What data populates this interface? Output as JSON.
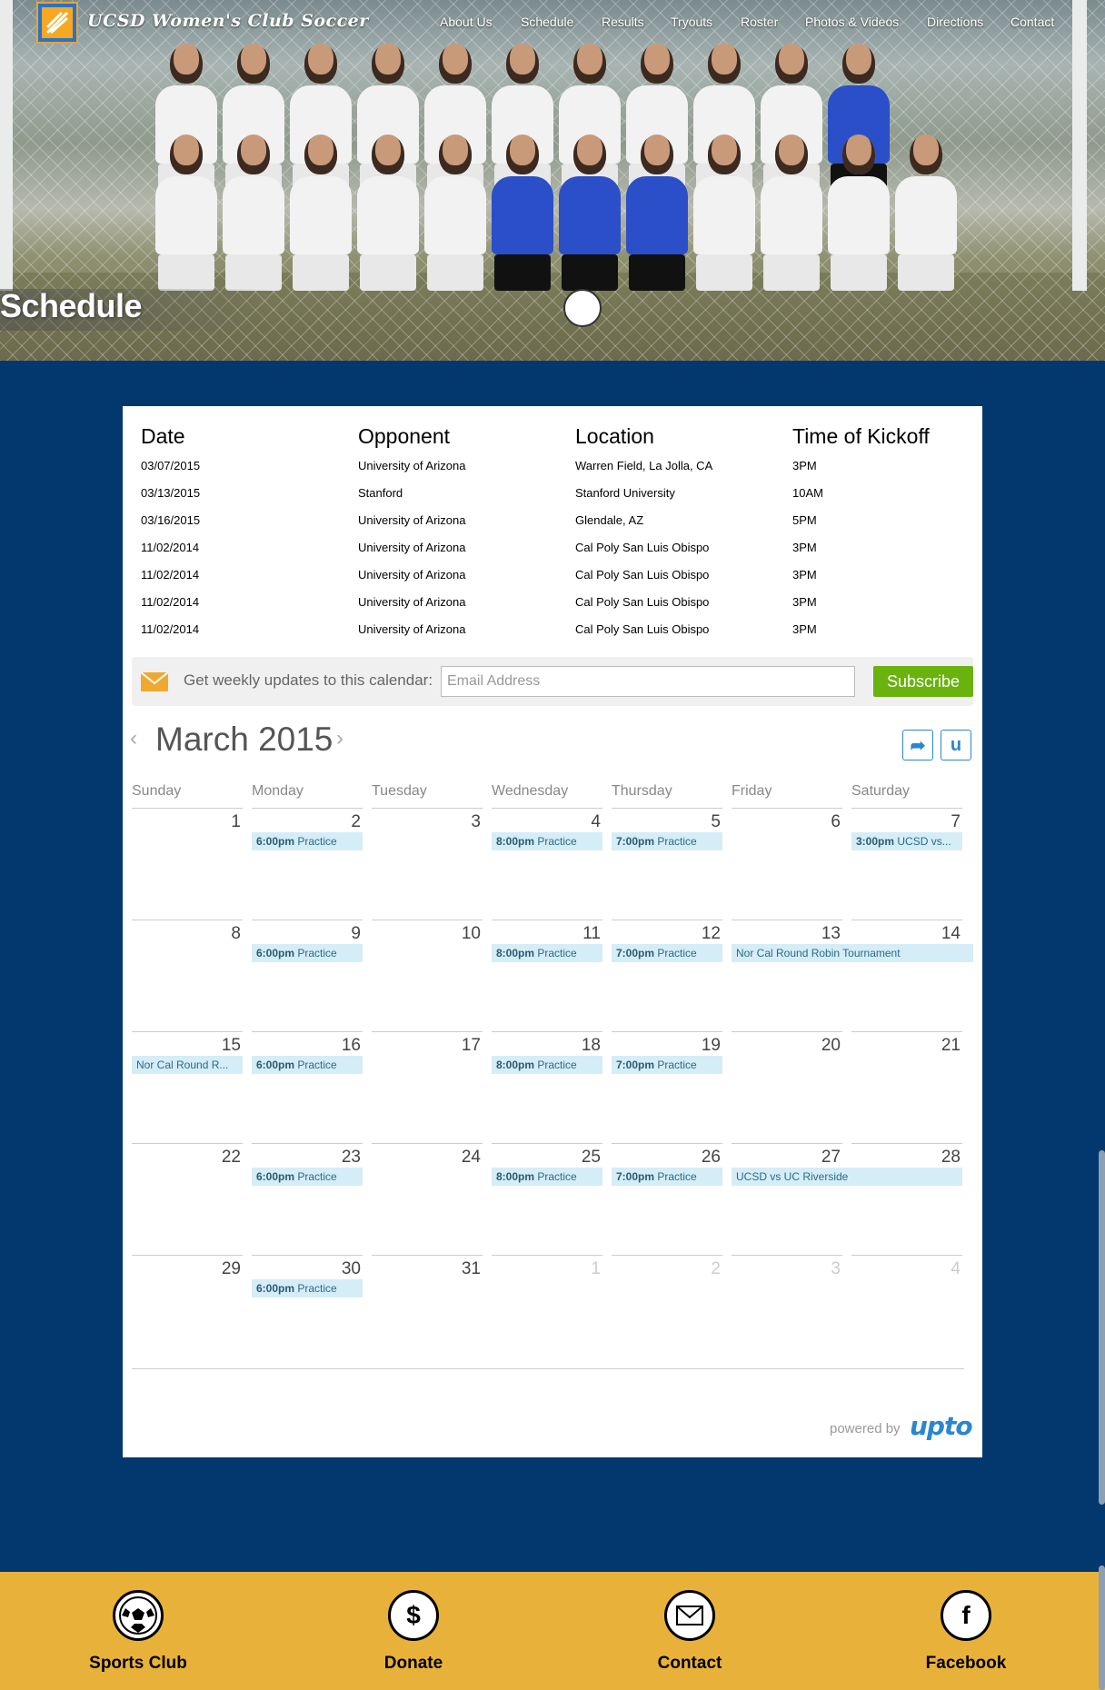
{
  "site": {
    "title": "UCSD Women's Club Soccer"
  },
  "nav": [
    "About Us",
    "Schedule",
    "Results",
    "Tryouts",
    "Roster",
    "Photos & Videos",
    "Directions",
    "Contact"
  ],
  "hero": {
    "title": "Schedule"
  },
  "schedule": {
    "headers": [
      "Date",
      "Opponent",
      "Location",
      "Time of Kickoff"
    ],
    "rows": [
      [
        "03/07/2015",
        "University of Arizona",
        "Warren Field, La Jolla, CA",
        "3PM"
      ],
      [
        "03/13/2015",
        "Stanford",
        "Stanford University",
        "10AM"
      ],
      [
        "03/16/2015",
        "University of Arizona",
        "Glendale, AZ",
        "5PM"
      ],
      [
        "11/02/2014",
        "University of Arizona",
        "Cal Poly San Luis Obispo",
        "3PM"
      ],
      [
        "11/02/2014",
        "University of Arizona",
        "Cal Poly San Luis Obispo",
        "3PM"
      ],
      [
        "11/02/2014",
        "University of Arizona",
        "Cal Poly San Luis Obispo",
        "3PM"
      ],
      [
        "11/02/2014",
        "University of Arizona",
        "Cal Poly San Luis Obispo",
        "3PM"
      ]
    ]
  },
  "subscribe": {
    "label": "Get weekly updates to this calendar:",
    "placeholder": "Email Address",
    "button": "Subscribe"
  },
  "calendar": {
    "month_label": "March 2015",
    "prev_icon": "chevron-left-icon",
    "next_icon": "chevron-right-icon",
    "weekdays": [
      "Sunday",
      "Monday",
      "Tuesday",
      "Wednesday",
      "Thursday",
      "Friday",
      "Saturday"
    ],
    "weeks": [
      [
        {
          "n": "1"
        },
        {
          "n": "2"
        },
        {
          "n": "3"
        },
        {
          "n": "4"
        },
        {
          "n": "5"
        },
        {
          "n": "6"
        },
        {
          "n": "7"
        }
      ],
      [
        {
          "n": "8"
        },
        {
          "n": "9"
        },
        {
          "n": "10"
        },
        {
          "n": "11"
        },
        {
          "n": "12"
        },
        {
          "n": "13"
        },
        {
          "n": "14"
        }
      ],
      [
        {
          "n": "15"
        },
        {
          "n": "16"
        },
        {
          "n": "17"
        },
        {
          "n": "18"
        },
        {
          "n": "19"
        },
        {
          "n": "20"
        },
        {
          "n": "21"
        }
      ],
      [
        {
          "n": "22"
        },
        {
          "n": "23"
        },
        {
          "n": "24"
        },
        {
          "n": "25"
        },
        {
          "n": "26"
        },
        {
          "n": "27"
        },
        {
          "n": "28"
        }
      ],
      [
        {
          "n": "29"
        },
        {
          "n": "30"
        },
        {
          "n": "31"
        },
        {
          "n": "1",
          "muted": true
        },
        {
          "n": "2",
          "muted": true
        },
        {
          "n": "3",
          "muted": true
        },
        {
          "n": "4",
          "muted": true
        }
      ]
    ],
    "events": [
      {
        "week": 0,
        "day": 1,
        "span": 1,
        "time": "6:00pm",
        "title": "Practice"
      },
      {
        "week": 0,
        "day": 3,
        "span": 1,
        "time": "8:00pm",
        "title": "Practice"
      },
      {
        "week": 0,
        "day": 4,
        "span": 1,
        "time": "7:00pm",
        "title": "Practice"
      },
      {
        "week": 0,
        "day": 6,
        "span": 1,
        "time": "3:00pm",
        "title": "UCSD vs..."
      },
      {
        "week": 1,
        "day": 1,
        "span": 1,
        "time": "6:00pm",
        "title": "Practice"
      },
      {
        "week": 1,
        "day": 3,
        "span": 1,
        "time": "8:00pm",
        "title": "Practice"
      },
      {
        "week": 1,
        "day": 4,
        "span": 1,
        "time": "7:00pm",
        "title": "Practice"
      },
      {
        "week": 1,
        "day": 5,
        "span": 2.2,
        "time": "",
        "title": "Nor Cal Round Robin Tournament"
      },
      {
        "week": 2,
        "day": 0,
        "span": 1,
        "time": "",
        "title": "Nor Cal Round R..."
      },
      {
        "week": 2,
        "day": 1,
        "span": 1,
        "time": "6:00pm",
        "title": "Practice"
      },
      {
        "week": 2,
        "day": 3,
        "span": 1,
        "time": "8:00pm",
        "title": "Practice"
      },
      {
        "week": 2,
        "day": 4,
        "span": 1,
        "time": "7:00pm",
        "title": "Practice"
      },
      {
        "week": 3,
        "day": 1,
        "span": 1,
        "time": "6:00pm",
        "title": "Practice"
      },
      {
        "week": 3,
        "day": 3,
        "span": 1,
        "time": "8:00pm",
        "title": "Practice"
      },
      {
        "week": 3,
        "day": 4,
        "span": 1,
        "time": "7:00pm",
        "title": "Practice"
      },
      {
        "week": 3,
        "day": 5,
        "span": 2,
        "time": "",
        "title": "UCSD vs UC Riverside"
      },
      {
        "week": 4,
        "day": 1,
        "span": 1,
        "time": "6:00pm",
        "title": "Practice"
      }
    ],
    "powered_by": "powered by",
    "brand": "upto"
  },
  "footer": [
    {
      "label": "Sports Club",
      "icon": "soccer-ball-icon"
    },
    {
      "label": "Donate",
      "icon": "dollar-icon"
    },
    {
      "label": "Contact",
      "icon": "envelope-icon"
    },
    {
      "label": "Facebook",
      "icon": "facebook-icon"
    }
  ],
  "colors": {
    "background": "#03386f",
    "footer": "#e8b23a",
    "subscribe": "#6ab20e",
    "event": "#d5edf7",
    "accent": "#2a86d1"
  }
}
